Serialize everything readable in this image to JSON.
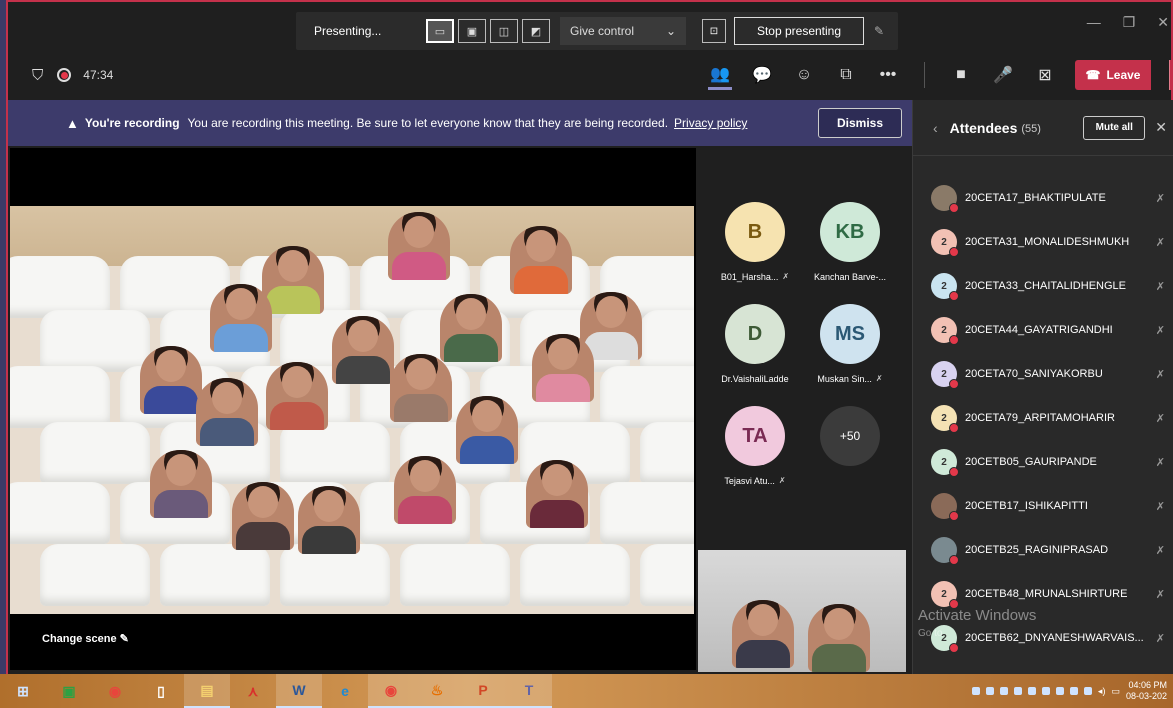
{
  "presenting_bar": {
    "label": "Presenting...",
    "give_control": "Give control",
    "stop_presenting": "Stop presenting"
  },
  "meeting": {
    "timer": "47:34",
    "leave_label": "Leave"
  },
  "banner": {
    "title": "You're recording",
    "message": "You are recording this meeting. Be sure to let everyone know that they are being recorded.",
    "privacy_link": "Privacy policy",
    "dismiss": "Dismiss"
  },
  "stage": {
    "change_scene": "Change scene"
  },
  "tiles": [
    {
      "initials": "B",
      "name": "B01_Harsha...",
      "bg": "#f6e3b0",
      "fg": "#7a5a10"
    },
    {
      "initials": "KB",
      "name": "Kanchan Barve-...",
      "bg": "#cfe9d8",
      "fg": "#2f6b45"
    },
    {
      "initials": "D",
      "name": "Dr.VaishaliLadde",
      "bg": "#d7e4d4",
      "fg": "#3d5a36"
    },
    {
      "initials": "MS",
      "name": "Muskan Sin...",
      "bg": "#cfe3ef",
      "fg": "#2b5874"
    },
    {
      "initials": "TA",
      "name": "Tejasvi Atu...",
      "bg": "#f1c9dd",
      "fg": "#7a2a53"
    },
    {
      "initials": "+50",
      "name": "",
      "bg": "#3b3b3b",
      "fg": "#ffffff"
    }
  ],
  "attendees": {
    "title": "Attendees",
    "count": "(55)",
    "mute_all": "Mute all",
    "list": [
      {
        "name": "20CETA17_BHAKTIPULATE",
        "avatar": "",
        "bg": "#8a7a68"
      },
      {
        "name": "20CETA31_MONALIDESHMUKH",
        "avatar": "2",
        "bg": "#f2c1b4"
      },
      {
        "name": "20CETA33_CHAITALIDHENGLE",
        "avatar": "2",
        "bg": "#c9e4f0"
      },
      {
        "name": "20CETA44_GAYATRIGANDHI",
        "avatar": "2",
        "bg": "#f2c1b4"
      },
      {
        "name": "20CETA70_SANIYAKORBU",
        "avatar": "2",
        "bg": "#d8d2f0"
      },
      {
        "name": "20CETA79_ARPITAMOHARIR",
        "avatar": "2",
        "bg": "#f4e2b4"
      },
      {
        "name": "20CETB05_GAURIPANDE",
        "avatar": "2",
        "bg": "#cfe9d8"
      },
      {
        "name": "20CETB17_ISHIKAPITTI",
        "avatar": "",
        "bg": "#8a6a58"
      },
      {
        "name": "20CETB25_RAGINIPRASAD",
        "avatar": "",
        "bg": "#7a8a90"
      },
      {
        "name": "20CETB48_MRUNALSHIRTURE",
        "avatar": "2",
        "bg": "#f2c1b4"
      },
      {
        "name": "20CETB62_DNYANESHWARVAIS...",
        "avatar": "2",
        "bg": "#cfe9d8"
      }
    ]
  },
  "watermark": {
    "line1": "Activate Windows",
    "line2": "Go to"
  },
  "taskbar": {
    "time": "04:06 PM",
    "date": "08-03-202"
  }
}
